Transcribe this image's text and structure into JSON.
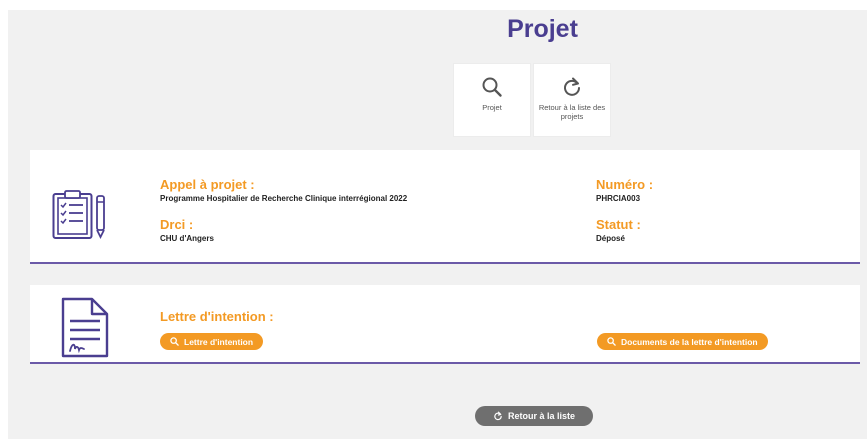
{
  "page": {
    "title": "Projet"
  },
  "actions": [
    {
      "label": "Projet",
      "icon": "search-icon"
    },
    {
      "label": "Retour à la liste des projets",
      "icon": "refresh-icon"
    }
  ],
  "summary": {
    "appel_heading": "Appel à projet :",
    "appel_value": "Programme Hospitalier de Recherche Clinique interrégional 2022",
    "numero_heading": "Numéro :",
    "numero_value": "PHRCIA003",
    "drci_heading": "Drci :",
    "drci_value": "CHU d'Angers",
    "statut_heading": "Statut :",
    "statut_value": "Déposé"
  },
  "lettre": {
    "heading": "Lettre d'intention :",
    "button_label": "Lettre d'intention",
    "docs_button_label": "Documents de la lettre d'intention"
  },
  "footer": {
    "back_label": "Retour à la liste"
  },
  "colors": {
    "accent": "#f39a24",
    "brand": "#4a3e90",
    "divider": "#6b5aa8",
    "back_button": "#6f6f6f"
  }
}
